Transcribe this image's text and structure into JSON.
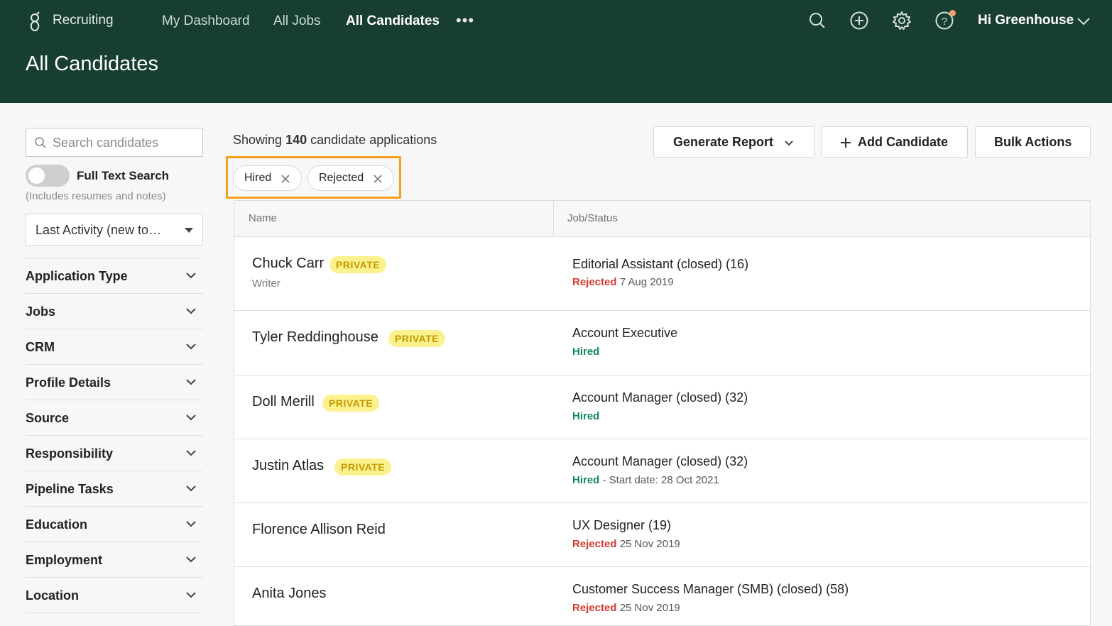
{
  "header": {
    "app_name": "Recruiting",
    "nav": [
      "My Dashboard",
      "All Jobs",
      "All Candidates"
    ],
    "active_nav": "All Candidates",
    "more": "•••",
    "user_greeting": "Hi Greenhouse",
    "page_title": "All Candidates",
    "icons": [
      "search-icon",
      "add-icon",
      "settings-icon",
      "help-icon"
    ],
    "colors": {
      "bar": "#173e31",
      "notification_dot": "#f5a071"
    }
  },
  "sidebar": {
    "search_placeholder": "Search candidates",
    "full_text_search_label": "Full Text Search",
    "full_text_search_note": "(Includes resumes and notes)",
    "full_text_search_on": false,
    "sort_value": "Last Activity (new to…",
    "filters": [
      "Application Type",
      "Jobs",
      "CRM",
      "Profile Details",
      "Source",
      "Responsibility",
      "Pipeline Tasks",
      "Education",
      "Employment",
      "Location"
    ]
  },
  "main": {
    "showing_prefix": "Showing",
    "showing_count": "140",
    "showing_suffix": "candidate applications",
    "buttons": {
      "generate_report": "Generate Report",
      "add_candidate": "Add Candidate",
      "bulk_actions": "Bulk Actions"
    },
    "active_filters": [
      "Hired",
      "Rejected"
    ],
    "columns": [
      "Name",
      "Job/Status"
    ],
    "private_label": "PRIVATE",
    "rows": [
      {
        "name": "Chuck Carr",
        "private": true,
        "title": "Writer",
        "job": "Editorial Assistant (closed) (16)",
        "status": "Rejected",
        "status_detail": "7 Aug 2019"
      },
      {
        "name": "Tyler Reddinghouse",
        "private": true,
        "title": "",
        "job": "Account Executive",
        "status": "Hired",
        "status_detail": ""
      },
      {
        "name": "Doll Merill",
        "private": true,
        "title": "",
        "job": "Account Manager (closed) (32)",
        "status": "Hired",
        "status_detail": ""
      },
      {
        "name": "Justin Atlas",
        "private": true,
        "title": "",
        "job": "Account Manager (closed) (32)",
        "status": "Hired",
        "status_detail": "- Start date: 28 Oct 2021"
      },
      {
        "name": "Florence Allison Reid",
        "private": false,
        "title": "",
        "job": "UX Designer (19)",
        "status": "Rejected",
        "status_detail": "25 Nov 2019"
      },
      {
        "name": "Anita Jones",
        "private": false,
        "title": "",
        "job": "Customer Success Manager (SMB) (closed) (58)",
        "status": "Rejected",
        "status_detail": "25 Nov 2019"
      }
    ],
    "colors": {
      "rejected": "#d6392f",
      "hired": "#0f8a5c",
      "private_badge_bg": "#fbf18e",
      "filter_highlight": "#f99d1c"
    }
  }
}
